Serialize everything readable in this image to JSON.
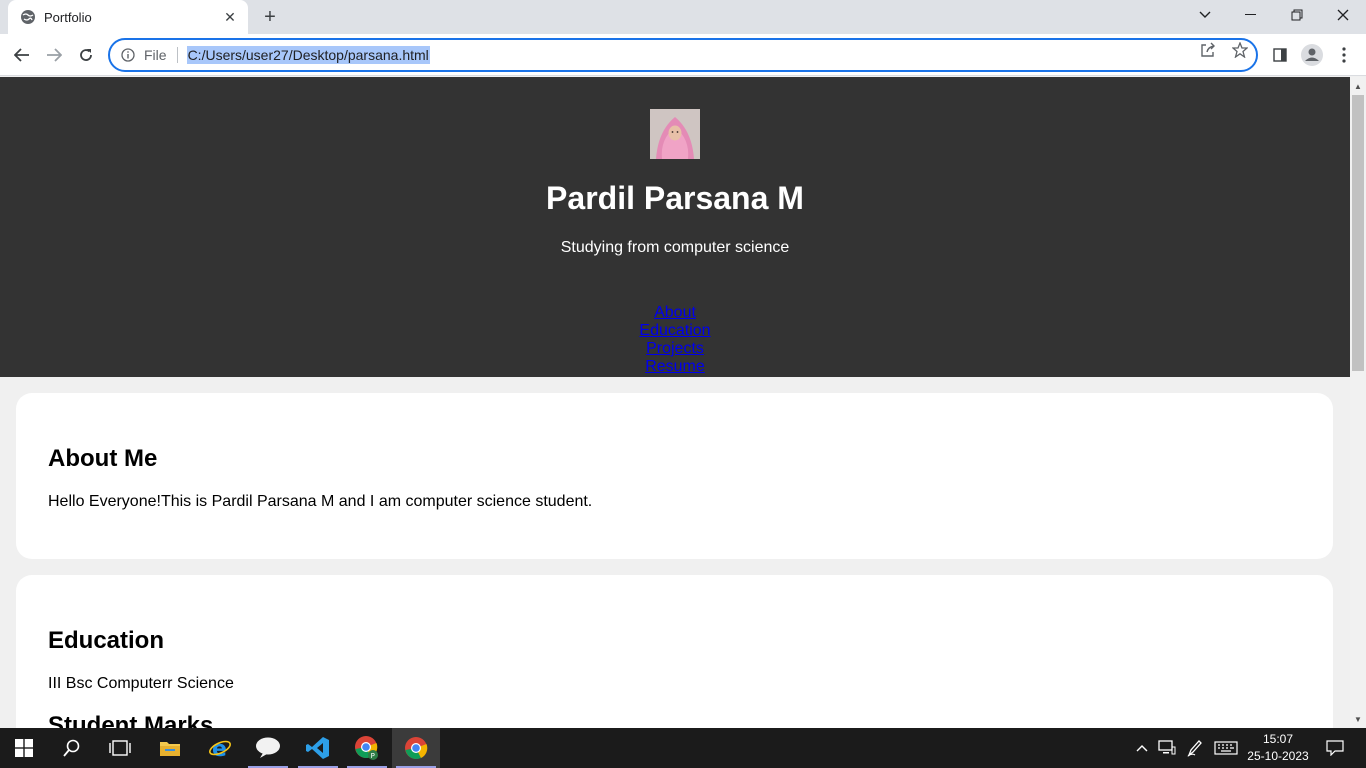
{
  "browser": {
    "tab_title": "Portfolio",
    "scheme_label": "File",
    "url": "C:/Users/user27/Desktop/parsana.html"
  },
  "hero": {
    "name": "Pardil Parsana M",
    "subtitle": "Studying from computer science",
    "nav": [
      "About",
      "Education",
      "Projects",
      "Resume"
    ]
  },
  "about": {
    "heading": "About Me",
    "text": "Hello Everyone!This is Pardil Parsana M and I am computer science student."
  },
  "education": {
    "heading": "Education",
    "text": "III Bsc Computerr Science",
    "subheading": "Student Marks"
  },
  "taskbar": {
    "time": "15:07",
    "date": "25-10-2023"
  },
  "colors": {
    "hero_bg": "#333333",
    "link": "#0000ee",
    "accent": "#1a73e8"
  }
}
